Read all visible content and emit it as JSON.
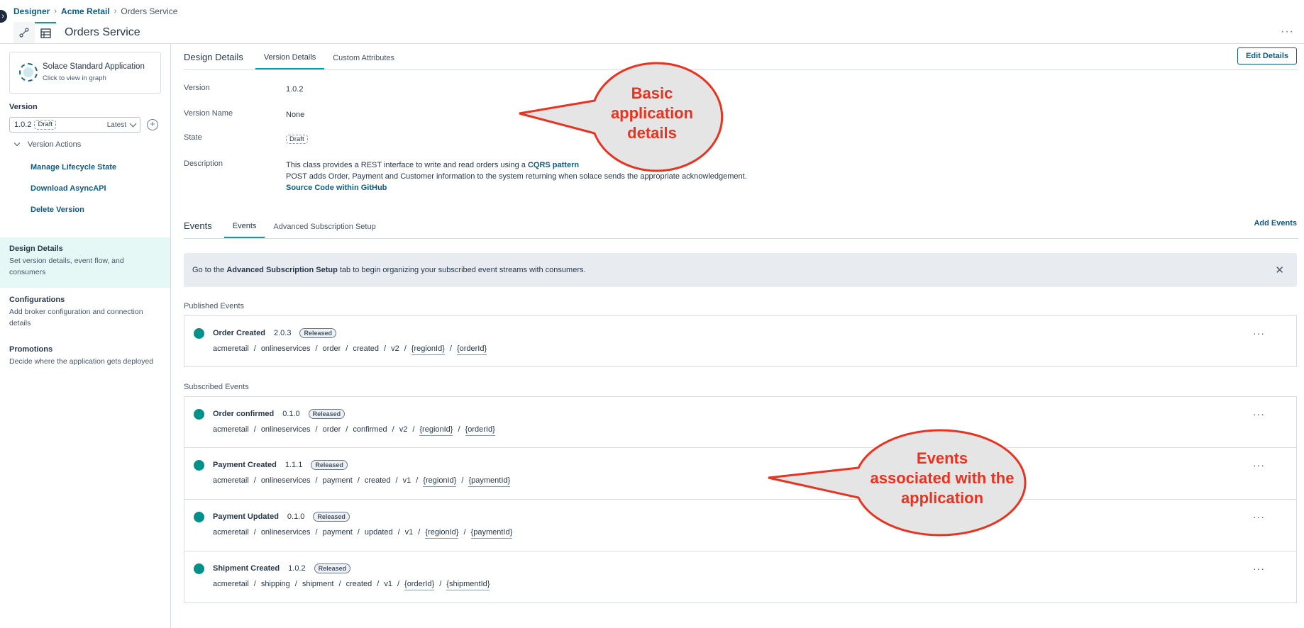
{
  "breadcrumb": {
    "items": [
      "Designer",
      "Acme Retail"
    ],
    "current": "Orders Service"
  },
  "header": {
    "title": "Orders Service",
    "more": "···"
  },
  "sidebar": {
    "app_card": {
      "name": "Solace Standard Application",
      "subtitle": "Click to view in graph"
    },
    "version_label": "Version",
    "version": {
      "value": "1.0.2",
      "badge": "Draft",
      "latest": "Latest"
    },
    "version_actions_label": "Version Actions",
    "actions": [
      "Manage Lifecycle State",
      "Download AsyncAPI",
      "Delete Version"
    ],
    "nav": [
      {
        "title": "Design Details",
        "desc": "Set version details, event flow, and consumers"
      },
      {
        "title": "Configurations",
        "desc": "Add broker configuration and connection details"
      },
      {
        "title": "Promotions",
        "desc": "Decide where the application gets deployed"
      }
    ]
  },
  "details": {
    "section_title": "Design Details",
    "tabs": [
      "Version Details",
      "Custom Attributes"
    ],
    "edit_button": "Edit Details",
    "rows": {
      "version": {
        "label": "Version",
        "value": "1.0.2"
      },
      "version_name": {
        "label": "Version Name",
        "value": "None"
      },
      "state": {
        "label": "State",
        "value": "Draft"
      },
      "description": {
        "label": "Description",
        "line1_prefix": "This class provides a REST interface to write and read orders using a",
        "line1_link": "CQRS pattern",
        "line2": "POST adds Order, Payment and Customer information to the system returning when solace sends the appropriate acknowledgement.",
        "line3_link": "Source Code within GitHub"
      }
    }
  },
  "events": {
    "section_title": "Events",
    "tabs": [
      "Events",
      "Advanced Subscription Setup"
    ],
    "add_button": "Add Events",
    "banner": {
      "prefix": "Go to the",
      "bold": "Advanced Subscription Setup",
      "suffix": "tab to begin organizing your subscribed event streams with consumers.",
      "close": "✕"
    },
    "published_label": "Published Events",
    "subscribed_label": "Subscribed Events",
    "published": [
      {
        "name": "Order Created",
        "version": "2.0.3",
        "status": "Released",
        "topic": [
          "acmeretail",
          "onlineservices",
          "order",
          "created",
          "v2",
          "{regionId}",
          "{orderId}"
        ]
      }
    ],
    "subscribed": [
      {
        "name": "Order confirmed",
        "version": "0.1.0",
        "status": "Released",
        "topic": [
          "acmeretail",
          "onlineservices",
          "order",
          "confirmed",
          "v2",
          "{regionId}",
          "{orderId}"
        ]
      },
      {
        "name": "Payment Created",
        "version": "1.1.1",
        "status": "Released",
        "topic": [
          "acmeretail",
          "onlineservices",
          "payment",
          "created",
          "v1",
          "{regionId}",
          "{paymentId}"
        ]
      },
      {
        "name": "Payment Updated",
        "version": "0.1.0",
        "status": "Released",
        "topic": [
          "acmeretail",
          "onlineservices",
          "payment",
          "updated",
          "v1",
          "{regionId}",
          "{paymentId}"
        ]
      },
      {
        "name": "Shipment Created",
        "version": "1.0.2",
        "status": "Released",
        "topic": [
          "acmeretail",
          "shipping",
          "shipment",
          "created",
          "v1",
          "{orderId}",
          "{shipmentId}"
        ]
      }
    ]
  },
  "callouts": {
    "details": [
      "Basic",
      "application",
      "details"
    ],
    "events": [
      "Events",
      "associated with the",
      "application"
    ]
  },
  "colors": {
    "accent": "#00a3a3",
    "link": "#0f5b81",
    "event_dot": "#00918a",
    "callout": "#e9321f"
  }
}
